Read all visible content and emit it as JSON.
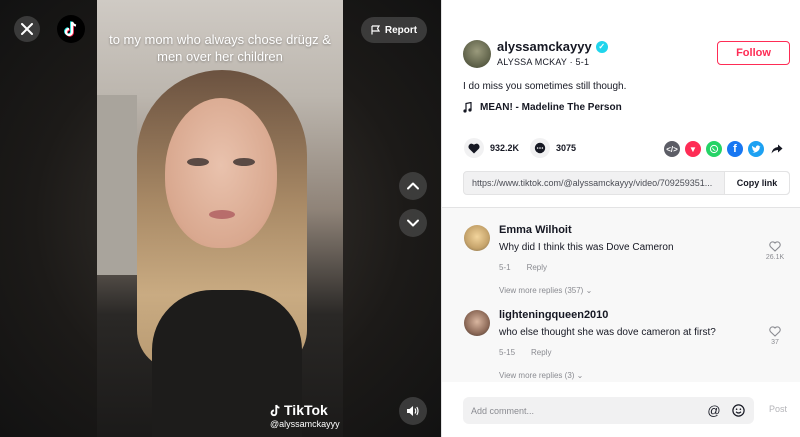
{
  "video": {
    "caption": "to my mom who always chose drügz & men over her children",
    "report_label": "Report",
    "watermark_brand": "TikTok",
    "watermark_user": "@alyssamckayyy"
  },
  "author": {
    "username": "alyssamckayyy",
    "display_name": "ALYSSA MCKAY",
    "date": "5-1",
    "follow_label": "Follow",
    "verified": true
  },
  "post": {
    "description": "I do miss you sometimes still though.",
    "music": "MEAN! - Madeline The Person",
    "likes": "932.2K",
    "comments": "3075"
  },
  "share_icons": [
    "embed-icon",
    "tiktok-share-icon",
    "whatsapp-icon",
    "facebook-icon",
    "twitter-icon",
    "share-arrow-icon"
  ],
  "colors": {
    "accent": "#fe2c55",
    "embed": "#5c5d66",
    "tiktok_share": "#fe2c55",
    "whatsapp": "#25d366",
    "facebook": "#1877f2",
    "twitter": "#1da1f2"
  },
  "link": {
    "url": "https://www.tiktok.com/@alyssamckayyy/video/709259351...",
    "copy_label": "Copy link"
  },
  "comment_list": [
    {
      "user": "Emma Wilhoit",
      "text": "Why did I think this was Dove Cameron",
      "date": "5-1",
      "reply_label": "Reply",
      "likes": "26.1K",
      "more": "View more replies (357)"
    },
    {
      "user": "lighteningqueen2010",
      "text": "who else thought she was dove cameron at first?",
      "date": "5-15",
      "reply_label": "Reply",
      "likes": "37",
      "more": "View more replies (3)"
    }
  ],
  "composer": {
    "placeholder": "Add comment...",
    "post_label": "Post"
  }
}
